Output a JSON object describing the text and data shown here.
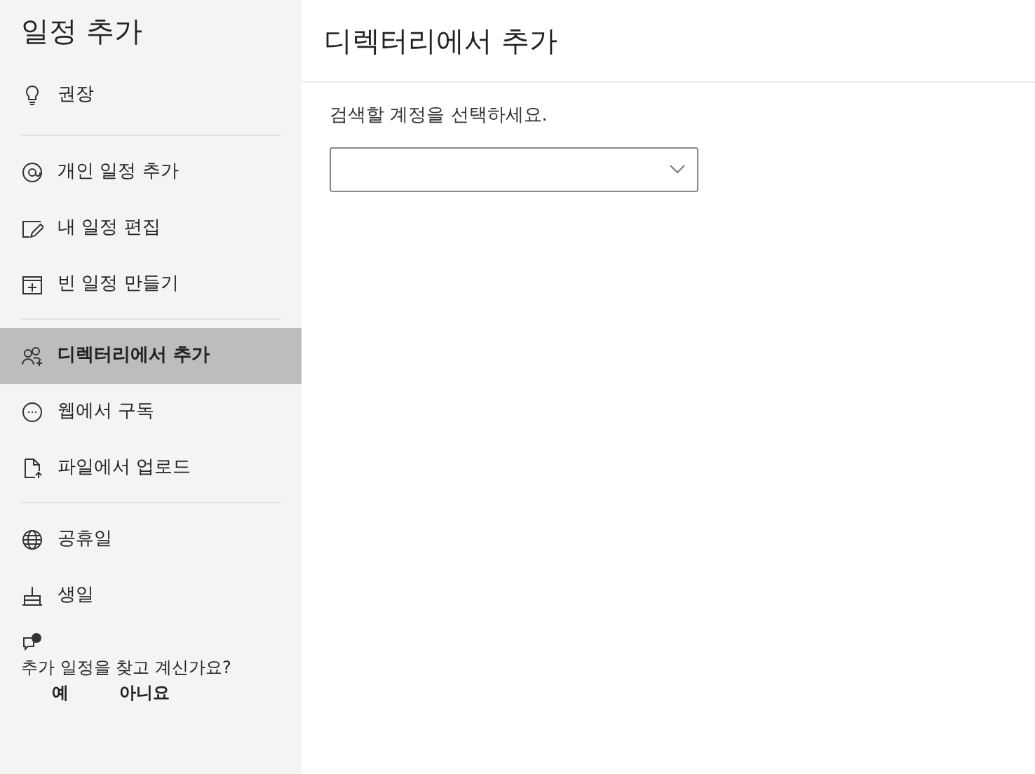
{
  "sidebar": {
    "title": "일정 추가",
    "groups": [
      {
        "items": [
          {
            "label": "권장",
            "selected": false
          }
        ]
      },
      {
        "items": [
          {
            "label": "개인 일정 추가",
            "selected": false
          },
          {
            "label": "내 일정 편집",
            "selected": false
          },
          {
            "label": "빈 일정 만들기",
            "selected": false
          }
        ]
      },
      {
        "items": [
          {
            "label": "디렉터리에서 추가",
            "selected": true
          },
          {
            "label": "웹에서 구독",
            "selected": false
          },
          {
            "label": "파일에서 업로드",
            "selected": false
          }
        ]
      },
      {
        "items": [
          {
            "label": "공휴일",
            "selected": false
          },
          {
            "label": "생일",
            "selected": false
          }
        ]
      }
    ],
    "feedback": {
      "question": "추가 일정을 찾고 계신가요?",
      "buttons": [
        "예",
        "아니요"
      ]
    }
  },
  "main": {
    "title": "디렉터리에서 추가",
    "prompt": "검색할 계정을 선택하세요."
  }
}
